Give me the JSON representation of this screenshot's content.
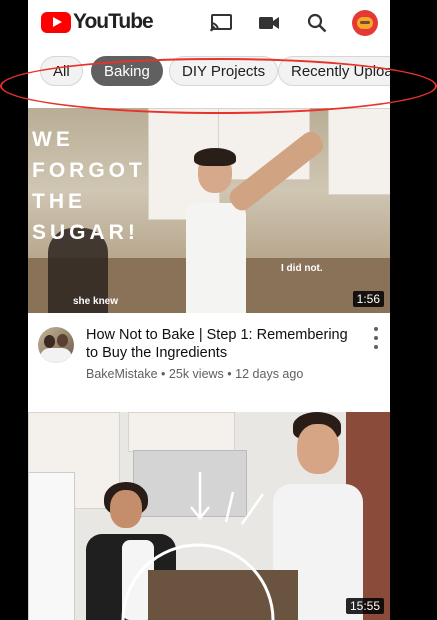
{
  "app": {
    "name": "YouTube"
  },
  "header": {
    "cast_icon": "cast-icon",
    "camera_icon": "video-camera-icon",
    "search_icon": "search-icon",
    "avatar_icon": "account-avatar"
  },
  "chips": [
    {
      "label": "All",
      "active": false
    },
    {
      "label": "Baking",
      "active": true
    },
    {
      "label": "DIY Projects",
      "active": false
    },
    {
      "label": "Recently Uploaded",
      "active": false
    }
  ],
  "videos": [
    {
      "thumbnail_text": "WE\nFORGOT\nTHE\nSUGAR!",
      "note_1": "I did not.",
      "note_2": "she knew",
      "duration": "1:56",
      "title": "How Not to Bake | Step 1: Remembering to Buy the Ingredients",
      "channel": "BakeMistake",
      "views": "25k views",
      "age": "12 days ago"
    },
    {
      "duration": "15:55"
    }
  ],
  "colors": {
    "brand_red": "#ff0000",
    "highlight": "#e8322a",
    "chip_active": "#606060"
  }
}
